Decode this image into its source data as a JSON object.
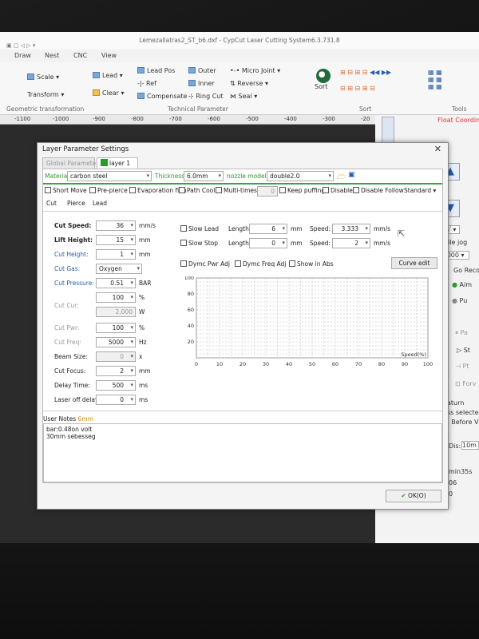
{
  "window": {
    "title": "Lemezallatras2_ST_b6.dxf - CypCut Laser Cutting System6.3.731.8"
  },
  "menu": [
    "Draw",
    "Nest",
    "CNC",
    "View"
  ],
  "ribbon": {
    "scale": "Scale",
    "transform": "Transform",
    "lead": "Lead",
    "clear": "Clear",
    "lead_pos": "Lead Pos",
    "ref": "Ref",
    "compensate": "Compensate",
    "outer": "Outer",
    "inner": "Inner",
    "ring_cut": "Ring Cut",
    "micro_joint": "Micro Joint",
    "reverse": "Reverse",
    "seal": "Seal",
    "sort": "Sort",
    "groups": [
      "Geometric transformation",
      "Technical Parameter",
      "Sort",
      "Tools"
    ]
  },
  "ruler": [
    "-1100",
    "-1000",
    "-900",
    "-800",
    "-700",
    "-600",
    "-500",
    "-400",
    "-300",
    "-20"
  ],
  "right_panel": {
    "float_coord": "Float Coordin",
    "hile_jog": "hile jog",
    "speed_sel": ":000",
    "go_reco": "Go Reco",
    "aim": "Aim",
    "pu": "Pu",
    "pa": "Pa",
    "st": "St",
    "pt": "Pt",
    "forv": "Forv",
    "return": "aturn",
    "ss_select": "ss selecte",
    "before": ": Before V",
    "dis_label": "Dis:",
    "dis_value": "10m",
    "time": "min35s",
    "v06": "06",
    "v0": "0"
  },
  "dialog": {
    "title": "Layer Parameter Settings",
    "close": "✕",
    "tab_global": "Global Parameter",
    "tab_layer": "layer 1",
    "material_label": "Material:",
    "material_value": "carbon steel",
    "thickness_label": "Thickness:",
    "thickness_value": "6.0mm",
    "nozzle_label": "nozzle model:",
    "nozzle_value": "double2.0",
    "options": [
      "Short Move",
      "Pre-pierce",
      "Evaporation film",
      "Path Cool",
      "Multi-times"
    ],
    "multi_count": "0",
    "options2": [
      "Keep puffing",
      "Disable",
      "Disable Follow"
    ],
    "standard": "Standard",
    "subtabs": [
      "Cut",
      "Pierce",
      "Lead"
    ],
    "params": [
      {
        "label": "Cut Speed:",
        "value": "36",
        "unit": "mm/s"
      },
      {
        "label": "Lift Height:",
        "value": "15",
        "unit": "mm"
      },
      {
        "label": "Cut Height:",
        "value": "1",
        "unit": "mm"
      },
      {
        "label": "Cut Gas:",
        "value": "Oxygen",
        "unit": ""
      },
      {
        "label": "Cut Pressure:",
        "value": "0.51",
        "unit": "BAR"
      },
      {
        "label": "",
        "value": "100",
        "unit": "%"
      },
      {
        "label": "Cut Cur:",
        "value": "2,000",
        "unit": "W"
      },
      {
        "label": "Cut Pwr:",
        "value": "100",
        "unit": "%"
      },
      {
        "label": "Cut Freq:",
        "value": "5000",
        "unit": "Hz"
      },
      {
        "label": "Beam Size:",
        "value": "0",
        "unit": "x"
      },
      {
        "label": "Cut Focus:",
        "value": "2",
        "unit": "mm"
      },
      {
        "label": "Delay Time:",
        "value": "500",
        "unit": "ms"
      },
      {
        "label": "Laser off delay",
        "value": "0",
        "unit": "ms"
      }
    ],
    "slow_lead": "Slow Lead",
    "slow_stop": "Slow Stop",
    "length_label": "Length:",
    "slow_lead_len": "6",
    "slow_stop_len": "0",
    "speed_label": "Speed:",
    "slow_lead_speed": "3.333",
    "slow_stop_speed": "2",
    "mm": "mm",
    "mms": "mm/s",
    "dymc_pwr": "Dymc Pwr Adj",
    "dymc_freq": "Dymc Freq Adj",
    "show_abs": "Show in Abs",
    "curve_edit": "Curve edit",
    "user_notes_label": "User Notes",
    "user_notes_val": "6mm",
    "notes": [
      "bar:0.48on volt",
      "30mm sebesseg"
    ],
    "ok": "OK(O)"
  },
  "chart_data": {
    "type": "line",
    "x_ticks": [
      "0",
      "10",
      "20",
      "30",
      "40",
      "50",
      "60",
      "70",
      "80",
      "90",
      "100"
    ],
    "y_ticks": [
      "20",
      "40",
      "60",
      "80",
      "100"
    ],
    "xlabel": "Speed(%)",
    "xlim": [
      0,
      100
    ],
    "ylim": [
      0,
      100
    ],
    "grid": true,
    "series": []
  }
}
